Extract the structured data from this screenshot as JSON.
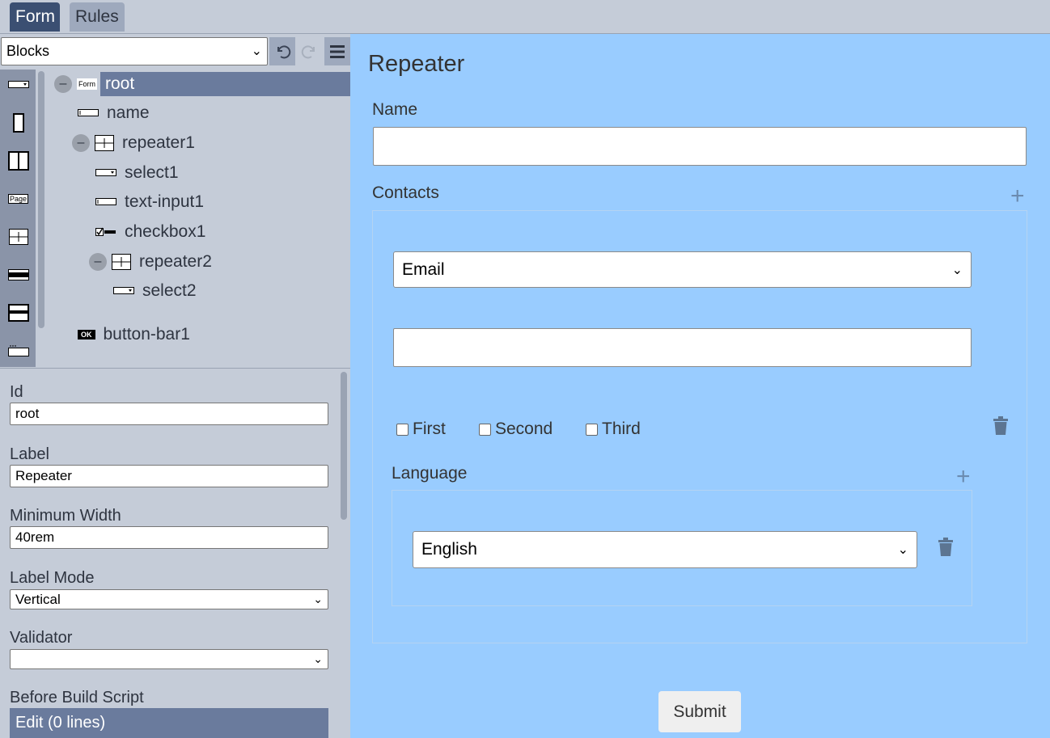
{
  "tabs": {
    "form": "Form",
    "rules": "Rules"
  },
  "toolbar": {
    "blocks_select": "Blocks"
  },
  "tree": {
    "root": "root",
    "root_icon_text": "Form",
    "name": "name",
    "repeater1": "repeater1",
    "select1": "select1",
    "text_input1": "text-input1",
    "checkbox1": "checkbox1",
    "repeater2": "repeater2",
    "select2": "select2",
    "button_bar1": "button-bar1",
    "button_icon_text": "OK"
  },
  "palette": {
    "page_icon_text": "Page"
  },
  "props": {
    "id_label": "Id",
    "id_value": "root",
    "label_label": "Label",
    "label_value": "Repeater",
    "min_width_label": "Minimum Width",
    "min_width_value": "40rem",
    "label_mode_label": "Label Mode",
    "label_mode_value": "Vertical",
    "validator_label": "Validator",
    "validator_value": "",
    "before_build_label": "Before Build Script",
    "edit_button": "Edit (0 lines)"
  },
  "preview": {
    "title": "Repeater",
    "name_label": "Name",
    "name_value": "",
    "contacts_label": "Contacts",
    "contact_type": "Email",
    "contact_value": "",
    "checkboxes": [
      "First",
      "Second",
      "Third"
    ],
    "language_label": "Language",
    "language_value": "English",
    "submit": "Submit"
  }
}
